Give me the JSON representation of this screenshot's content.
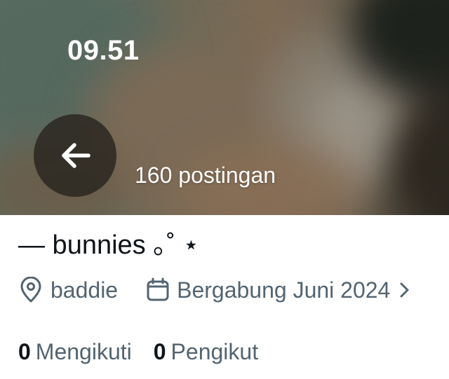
{
  "status_bar": {
    "time": "09.51"
  },
  "header": {
    "back_icon": "arrow-left-icon",
    "post_count": "160 postingan"
  },
  "profile": {
    "display_name": "— bunnies ｡˚ ⋆",
    "location": "baddie",
    "location_icon": "location-pin-icon",
    "joined": "Bergabung Juni 2024",
    "joined_icon": "calendar-icon",
    "expand_icon": "chevron-right-icon"
  },
  "stats": {
    "following_count": "0",
    "following_label": "Mengikuti",
    "followers_count": "0",
    "followers_label": "Pengikut"
  },
  "colors": {
    "text_primary": "#0f1419",
    "text_secondary": "#536471",
    "banner_overlay": "#28241e"
  }
}
